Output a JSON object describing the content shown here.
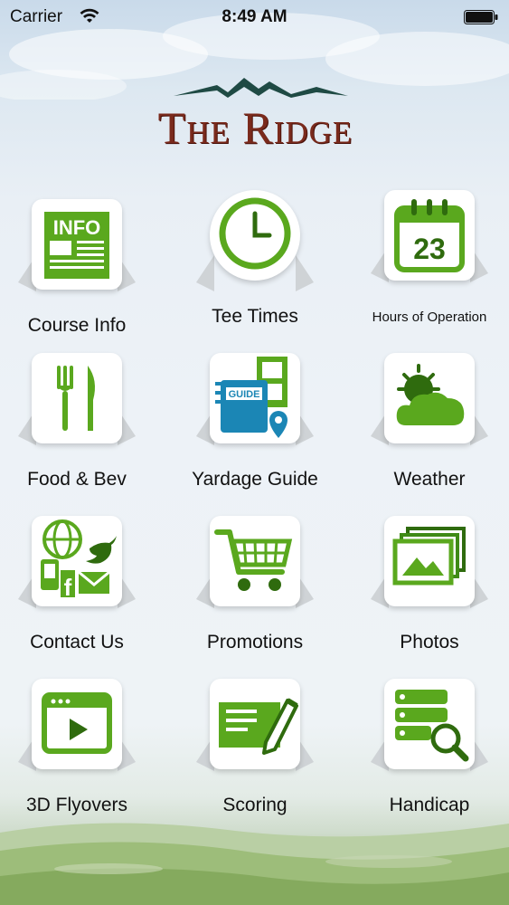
{
  "status_bar": {
    "carrier": "Carrier",
    "time": "8:49 AM"
  },
  "logo": {
    "title": "The Ridge"
  },
  "menu": [
    {
      "label": "Course Info",
      "icon": "info-newspaper-icon"
    },
    {
      "label": "Tee Times",
      "icon": "clock-icon"
    },
    {
      "label": "Hours of Operation",
      "icon": "calendar-icon",
      "day": "23"
    },
    {
      "label": "Food & Bev",
      "icon": "fork-knife-icon"
    },
    {
      "label": "Yardage Guide",
      "icon": "yardage-guide-icon",
      "badge": "GUIDE"
    },
    {
      "label": "Weather",
      "icon": "weather-icon"
    },
    {
      "label": "Contact Us",
      "icon": "contact-icon"
    },
    {
      "label": "Promotions",
      "icon": "cart-icon"
    },
    {
      "label": "Photos",
      "icon": "photos-icon"
    },
    {
      "label": "3D Flyovers",
      "icon": "video-play-icon"
    },
    {
      "label": "Scoring",
      "icon": "scorecard-pencil-icon"
    },
    {
      "label": "Handicap",
      "icon": "handicap-search-icon"
    }
  ],
  "colors": {
    "accent_green": "#5aa81e",
    "logo_red": "#7a2a1c",
    "logo_mountain": "#1f4a44",
    "guide_blue": "#1b86b5"
  }
}
